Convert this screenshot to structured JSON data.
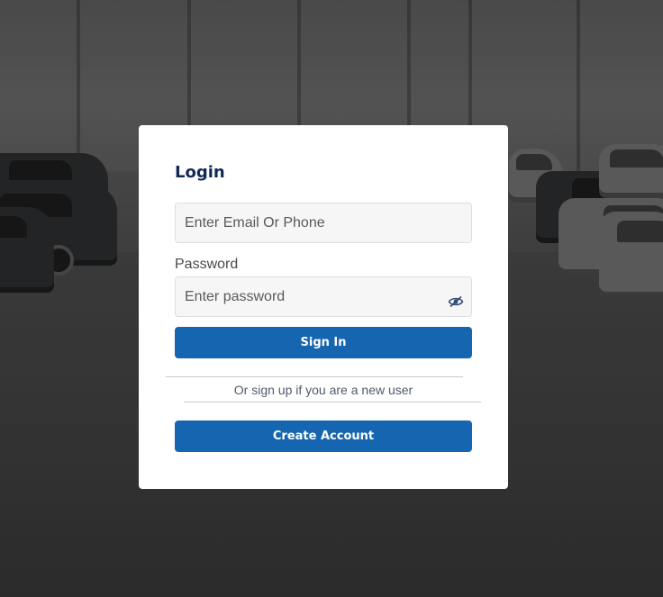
{
  "login": {
    "title": "Login",
    "email_placeholder": "Enter Email Or Phone",
    "password_label": "Password",
    "password_placeholder": "Enter password",
    "password_toggle_icon": "eye-slash-icon",
    "signin_label": "Sign In",
    "alt_text": "Or sign up if you are a new user",
    "create_label": "Create Account"
  },
  "colors": {
    "primary": "#1565b0",
    "title": "#102a56",
    "input_bg": "#f6f6f6",
    "card_bg": "#ffffff"
  }
}
